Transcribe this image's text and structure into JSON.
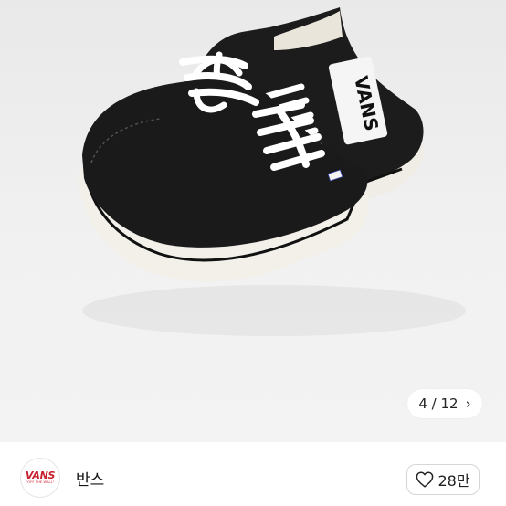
{
  "gallery": {
    "current": "4",
    "separator": "/",
    "total": "12",
    "counter_text": "4 / 12",
    "next_icon": "chevron-right-icon"
  },
  "product_image": {
    "brand_side_text": "VANS",
    "colors": {
      "upper": "#1b1b1b",
      "sole": "#f3f1ea",
      "laces": "#ffffff"
    }
  },
  "shop": {
    "name": "반스",
    "logo_text": "VANS",
    "logo_tagline": "\"OFF THE WALL\"",
    "logo_color": "#c8202f"
  },
  "like": {
    "icon": "heart-outline-icon",
    "count": "28만"
  }
}
